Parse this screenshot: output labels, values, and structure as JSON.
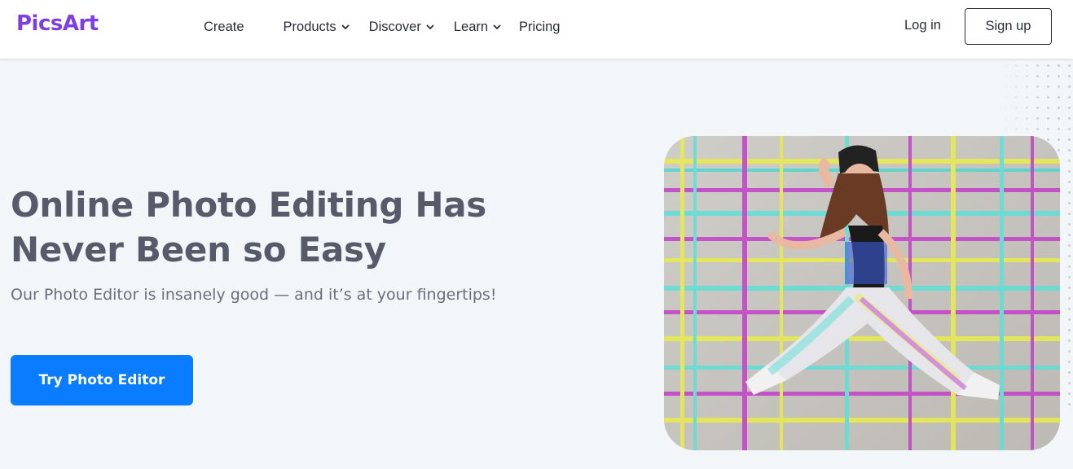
{
  "brand": {
    "logo_text": "PicsArt",
    "color": "#7b3fe4"
  },
  "nav": {
    "items": [
      {
        "label": "Create",
        "dropdown": false
      },
      {
        "label": "Products",
        "dropdown": true
      },
      {
        "label": "Discover",
        "dropdown": true
      },
      {
        "label": "Learn",
        "dropdown": true
      },
      {
        "label": "Pricing",
        "dropdown": false
      }
    ],
    "login_label": "Log in",
    "signup_label": "Sign up"
  },
  "hero": {
    "headline_line1": "Online Photo Editing Has",
    "headline_line2": "Never Been so Easy",
    "subheadline": "Our Photo Editor is insanely good — and it’s at your fingertips!",
    "cta_label": "Try Photo Editor",
    "cta_color": "#0a7cff",
    "image_subject": "woman-jumping-glitch-photo"
  },
  "colors": {
    "background": "#f3f6f9",
    "text": "#575a69"
  }
}
